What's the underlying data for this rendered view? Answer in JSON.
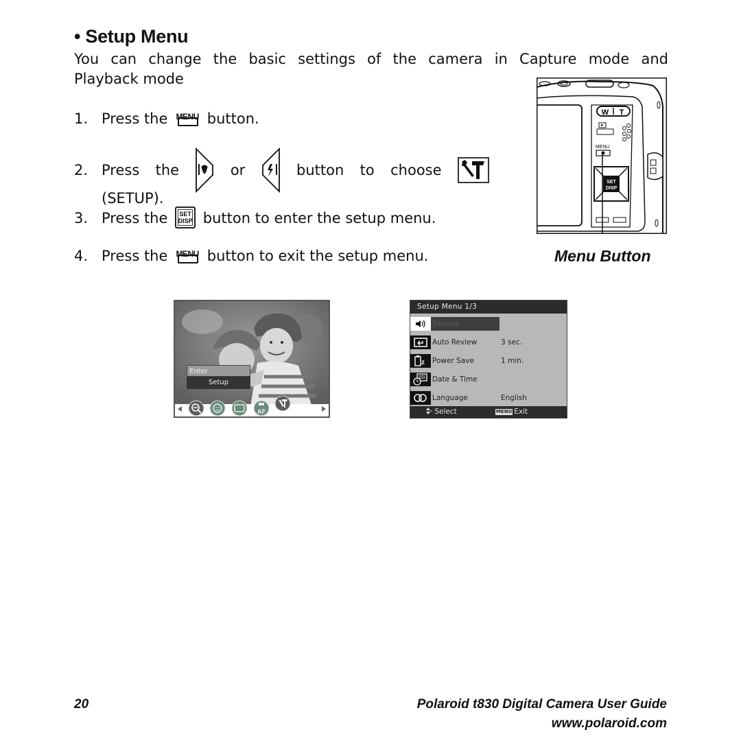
{
  "section": {
    "bullet": "•",
    "title": "Setup Menu",
    "intro_line1": "You can change the basic settings of the camera in Capture mode and",
    "intro_line2": "Playback mode"
  },
  "steps": [
    {
      "num": "1.",
      "pre": "Press the",
      "icon": "menu-button-icon",
      "post": "button."
    },
    {
      "num": "2.",
      "pre": "Press",
      "the": "the",
      "or": "or",
      "mid": "button",
      "to": "to",
      "choose": "choose",
      "cont": "(SETUP).",
      "icons": [
        "left-macro-button-icon",
        "right-flash-button-icon",
        "setup-tool-icon"
      ]
    },
    {
      "num": "3.",
      "pre": "Press the",
      "icon": "set-disp-button-icon",
      "post": "button to enter the setup menu."
    },
    {
      "num": "4.",
      "pre": "Press the",
      "icon": "menu-button-icon",
      "post": "button to exit the setup menu."
    }
  ],
  "glyph_labels": {
    "menu": "MENU",
    "set": "SET",
    "disp": "DISP"
  },
  "camera_illustration": {
    "caption": "Menu Button",
    "labels": {
      "w": "W",
      "t": "T",
      "menu": "MENU",
      "set": "SET",
      "disp": "DISP"
    }
  },
  "lcd_capture": {
    "popup_enter": "Enter",
    "popup_setup": "Setup",
    "icons": [
      "zoom-icon",
      "face-detect-icon",
      "frame-icon",
      "af-lamp-icon",
      "setup-tool-icon"
    ],
    "af_label": "AF"
  },
  "lcd_setup": {
    "header": "Setup Menu  1/3",
    "rows": [
      {
        "icon": "sound-icon",
        "label": "Sounds",
        "value": "",
        "selected": true
      },
      {
        "icon": "auto-review-icon",
        "label": "Auto Review",
        "value": "3 sec."
      },
      {
        "icon": "power-save-icon",
        "label": "Power Save",
        "value": "1 min."
      },
      {
        "icon": "date-time-icon",
        "label": "Date & Time",
        "value": ""
      },
      {
        "icon": "language-icon",
        "label": "Language",
        "value": "English"
      }
    ],
    "footer_select": "Select",
    "footer_menu_chip": "MENU",
    "footer_exit": "Exit"
  },
  "footer": {
    "page_number": "20",
    "guide_title": "Polaroid t830 Digital Camera User Guide",
    "url": "www.polaroid.com"
  }
}
